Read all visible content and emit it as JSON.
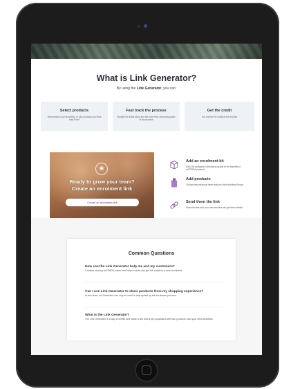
{
  "page": {
    "title": "What is Link Generator?",
    "subtitle_prefix": "By using the ",
    "subtitle_bold": "Link Generator",
    "subtitle_suffix": ", you can:"
  },
  "features": [
    {
      "title": "Select products",
      "desc": "Recommend your favourites, or pick products you think they'll love"
    },
    {
      "title": "Fast track the process",
      "desc": "Simplify the initial setup and the more time consuming parts of the process"
    },
    {
      "title": "Get the credit",
      "desc": "You receive the credit as the enroller"
    }
  ],
  "promo": {
    "line1": "Ready to grow your team?",
    "line2": "Create an enrolment link",
    "button": "Create an enrolment link",
    "logo_glyph": "❀"
  },
  "steps": [
    {
      "icon": "box-icon",
      "title": "Add an enrolment kit",
      "desc": "Add a kit designed to introduce people to the benefits of doTERRA products"
    },
    {
      "icon": "bottle-icon",
      "title": "Add products",
      "desc": "Choose any individual items that you think that they'll enjoy"
    },
    {
      "icon": "link-icon",
      "title": "Send them the link",
      "desc": "Share the link with your new enrollee and get them started"
    }
  ],
  "faq": {
    "title": "Common Questions",
    "items": [
      {
        "q": "How can the Link Generator help me and my customers?",
        "a": "It makes sharing doTERRA easier and helps ensure you get the credit for a new enrolment."
      },
      {
        "q": "Can I use Link Generator to share products from my shopping experience?",
        "a": "At this time Link Generator can only be used to help speed up the enrolment process."
      },
      {
        "q": "What is the Link Generator?",
        "a": "The Link Generator is a way to create and share a link that is pre-populated with kits, products, and your referral details."
      }
    ]
  },
  "colors": {
    "accent": "#7a2a85",
    "heading": "#2b2f3a",
    "feature_bg": "#eef2f7",
    "icon": "#8a5ba8"
  }
}
